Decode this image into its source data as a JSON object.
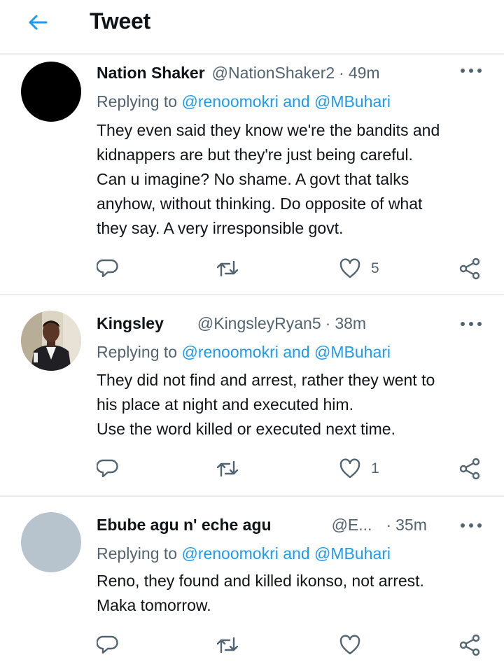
{
  "header": {
    "title": "Tweet"
  },
  "tweets": [
    {
      "name": "Nation Shaker",
      "handle": "@NationShaker2",
      "time": "49m",
      "replying_prefix": "Replying to ",
      "replying_to": "@renoomokri and @MBuhari",
      "text": "They even said they know we're the bandits and\nkidnappers are but they're just being careful.\nCan u imagine? No shame. A govt that talks\nanyhow, without thinking. Do opposite of what\nthey say. A very irresponsible govt.",
      "likes": "5"
    },
    {
      "name": "Kingsley",
      "handle": "@KingsleyRyan5",
      "time": "38m",
      "replying_prefix": "Replying to ",
      "replying_to": "@renoomokri and @MBuhari",
      "text": "They did not find and arrest, rather they went to\nhis place at night and executed him.\nUse the word killed or executed next time.",
      "likes": "1"
    },
    {
      "name": "Ebube agu n' eche agu",
      "handle": "@E...",
      "time": "35m",
      "replying_prefix": "Replying to ",
      "replying_to": "@renoomokri and @MBuhari",
      "text": "Reno, they found and killed ikonso, not arrest.\nMaka tomorrow.",
      "likes": ""
    }
  ],
  "dot": "·",
  "colors": {
    "accent": "#1d9bf0",
    "text": "#0f1419",
    "muted": "#536471",
    "divider": "#e6ecf0"
  },
  "icons": [
    "back-arrow-icon",
    "more-icon",
    "reply-icon",
    "retweet-icon",
    "like-icon",
    "share-icon"
  ]
}
